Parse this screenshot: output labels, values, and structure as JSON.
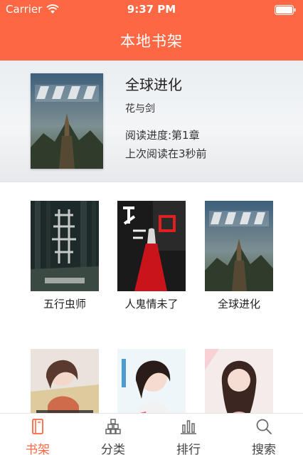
{
  "status_bar": {
    "carrier": "Carrier",
    "time": "9:37 PM"
  },
  "nav": {
    "title": "本地书架"
  },
  "featured": {
    "title": "全球进化",
    "author": "花与剑",
    "progress": "阅读进度:第1章",
    "last_read": "上次阅读在3秒前"
  },
  "books": [
    {
      "title": "五行虫师"
    },
    {
      "title": "人鬼情未了"
    },
    {
      "title": "全球进化"
    },
    {
      "title": ""
    },
    {
      "title": ""
    },
    {
      "title": ""
    }
  ],
  "tabs": [
    {
      "label": "书架",
      "icon": "bookshelf-icon",
      "active": true
    },
    {
      "label": "分类",
      "icon": "category-icon",
      "active": false
    },
    {
      "label": "排行",
      "icon": "ranking-icon",
      "active": false
    },
    {
      "label": "搜索",
      "icon": "search-icon",
      "active": false
    }
  ],
  "colors": {
    "accent": "#fd6743",
    "text": "#222222"
  }
}
